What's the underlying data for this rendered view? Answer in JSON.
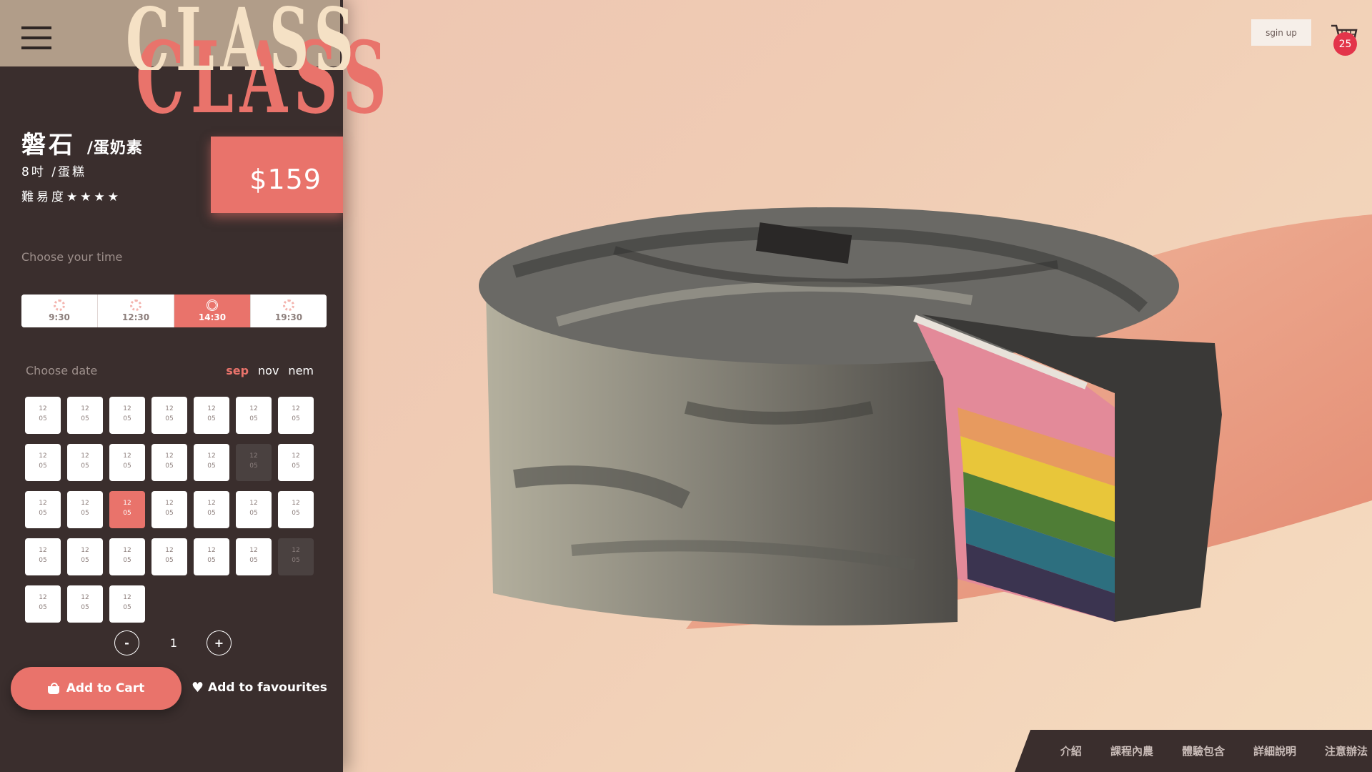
{
  "brand": {
    "logo_text": "CLASS"
  },
  "product": {
    "name": "磐石",
    "type": "/蛋奶素",
    "size": "8吋 /蛋糕",
    "difficulty": "難易度★★★★",
    "price": "$159"
  },
  "time": {
    "label": "Choose your time",
    "options": [
      "9:30",
      "12:30",
      "14:30",
      "19:30"
    ],
    "selected": "14:30"
  },
  "date": {
    "label": "Choose date",
    "months": [
      "sep",
      "nov",
      "nem"
    ],
    "active_month": "sep",
    "day": "12",
    "month_num": "05",
    "count": 31,
    "selected_index": 16,
    "disabled_indices": [
      12,
      27
    ]
  },
  "quantity": {
    "minus": "-",
    "value": "1",
    "plus": "+"
  },
  "actions": {
    "add_to_cart": "Add to Cart",
    "add_to_favourites": "Add to favourites"
  },
  "header": {
    "signup": "sgin up",
    "cart_count": "25"
  },
  "bottom_nav": [
    "介紹",
    "課程內農",
    "體驗包含",
    "詳細說明",
    "注意辦法"
  ],
  "colors": {
    "accent": "#e9736b",
    "panel": "#3a2e2d",
    "badge": "#e3354a"
  }
}
